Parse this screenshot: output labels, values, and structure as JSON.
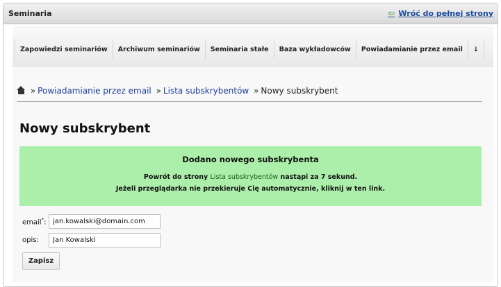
{
  "topbar": {
    "title": "Seminaria",
    "back_link": "Wróć do pełnej strony"
  },
  "nav": {
    "items": [
      {
        "label": "Zapowiedzi seminariów"
      },
      {
        "label": "Archiwum seminariów"
      },
      {
        "label": "Seminaria stałe"
      },
      {
        "label": "Baza wykładowców"
      },
      {
        "label": "Powiadamianie przez email"
      },
      {
        "label": "↓"
      }
    ]
  },
  "breadcrumb": {
    "sep": "»",
    "items": [
      "Powiadamianie przez email",
      "Lista subskrybentów"
    ],
    "current": "Nowy subskrybent"
  },
  "page": {
    "title": "Nowy subskrybent"
  },
  "notice": {
    "heading": "Dodano nowego subskrybenta",
    "line1_pre": "Powrót do strony ",
    "line1_link": "Lista subskrybentów",
    "line1_post": " nastąpi za 7 sekund.",
    "line2": "Jeżeli przeglądarka nie przekieruje Cię automatycznie, kliknij w ten link."
  },
  "form": {
    "email_label": "email",
    "email_required_mark": "*",
    "email_colon": ":",
    "email_value": "jan.kowalski@domain.com",
    "desc_label": "opis:",
    "desc_value": "Jan Kowalski",
    "save_label": "Zapisz"
  }
}
